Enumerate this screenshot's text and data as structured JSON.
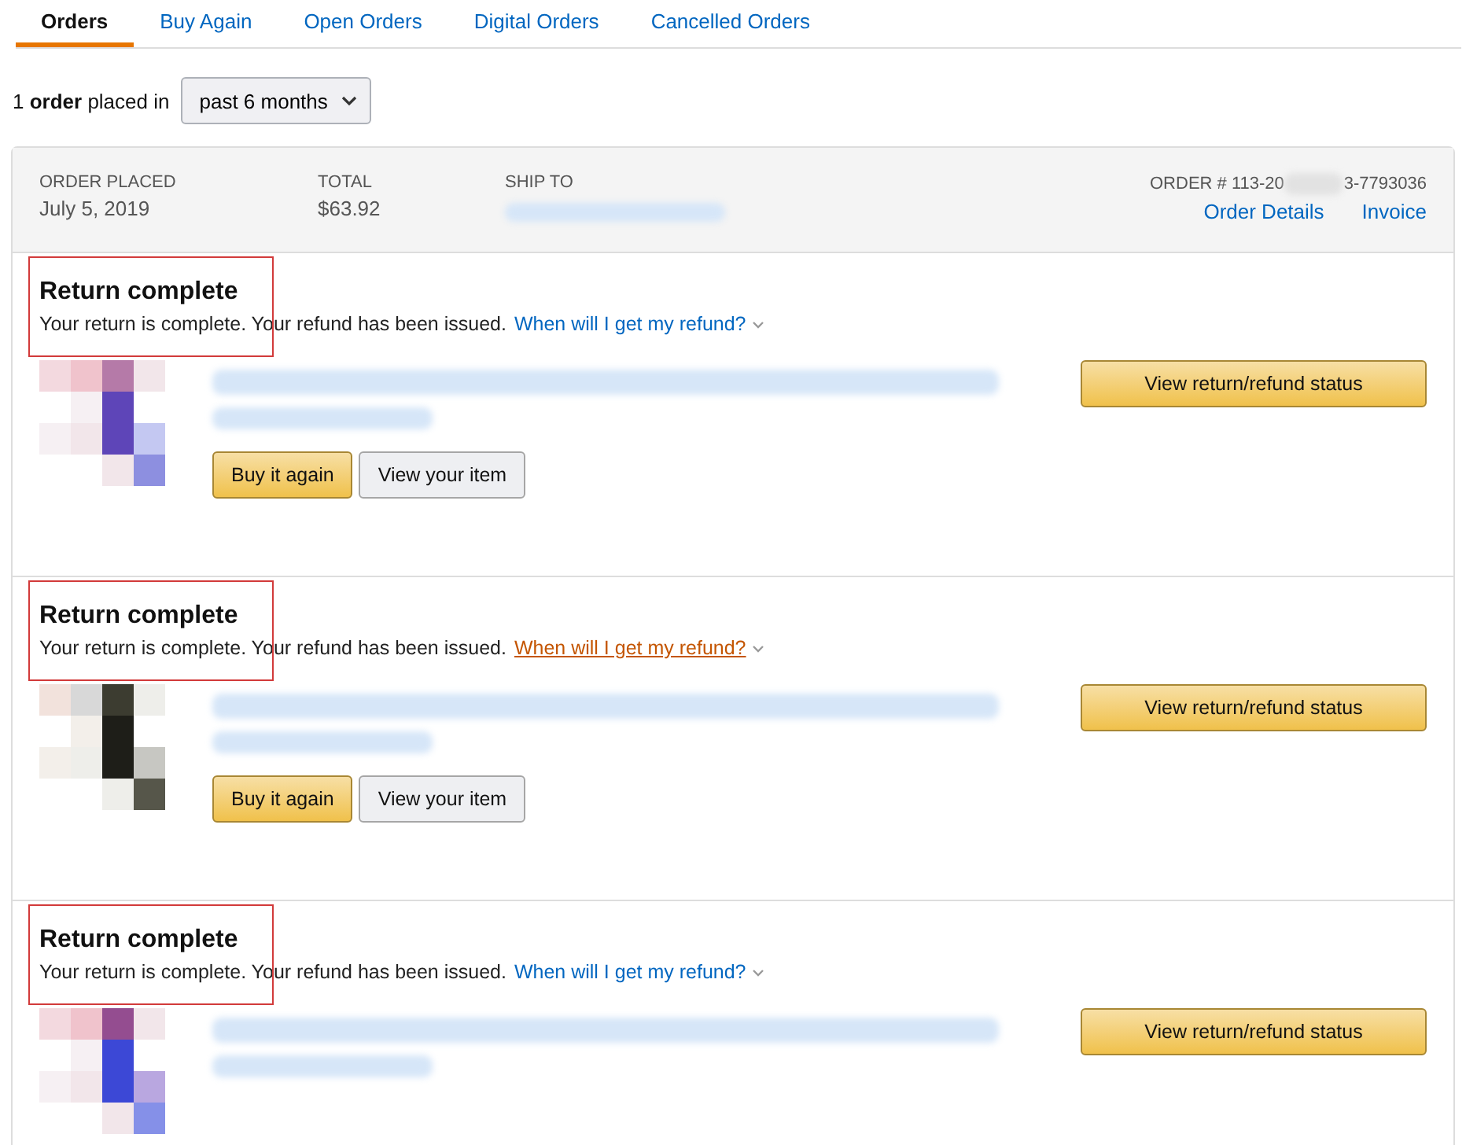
{
  "tabs": [
    {
      "label": "Orders",
      "selected": true
    },
    {
      "label": "Buy Again",
      "selected": false
    },
    {
      "label": "Open Orders",
      "selected": false
    },
    {
      "label": "Digital Orders",
      "selected": false
    },
    {
      "label": "Cancelled Orders",
      "selected": false
    }
  ],
  "filter": {
    "summary": "1 **order** placed in",
    "period": "past 6 months"
  },
  "order": {
    "placed_label": "ORDER PLACED",
    "placed": "July 5, 2019",
    "total_label": "TOTAL",
    "total": "$63.92",
    "ship_to_label": "SHIP TO",
    "number_start": "ORDER # 113-20",
    "number_end": "3-7793036",
    "links": [
      "Order Details",
      "Invoice"
    ]
  },
  "shipments": [
    {
      "status": "Return complete",
      "message": "Your return is complete. Your refund has been issued.",
      "refund_link": "When will I get my refund?",
      "link_hovered": false,
      "status_button": "View return/refund status",
      "buttons": [
        "Buy it again",
        "View your item"
      ]
    },
    {
      "status": "Return complete",
      "message": "Your return is complete. Your refund has been issued.",
      "refund_link": "When will I get my refund?",
      "link_hovered": true,
      "status_button": "View return/refund status",
      "buttons": [
        "Buy it again",
        "View your item"
      ]
    },
    {
      "status": "Return complete",
      "message": "Your return is complete. Your refund has been issued.",
      "refund_link": "When will I get my refund?",
      "link_hovered": false,
      "status_button": "View return/refund status"
    }
  ]
}
